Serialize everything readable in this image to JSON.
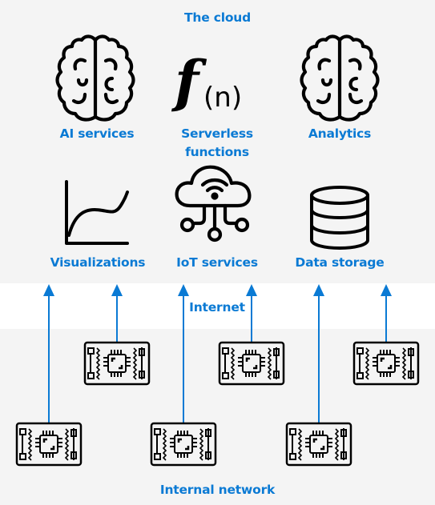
{
  "accent_color": "#0a7ad4",
  "zones": {
    "cloud": "The cloud",
    "internet": "Internet",
    "internal": "Internal network"
  },
  "services": [
    {
      "label": "AI services",
      "icon": "brain-icon"
    },
    {
      "label": "Serverless functions",
      "icon": "function-icon",
      "line1": "Serverless",
      "line2": "functions",
      "glyph_main": "f",
      "glyph_sub": "(n)"
    },
    {
      "label": "Analytics",
      "icon": "brain-icon"
    },
    {
      "label": "Visualizations",
      "icon": "line-chart-icon"
    },
    {
      "label": "IoT services",
      "icon": "iot-cloud-icon"
    },
    {
      "label": "Data storage",
      "icon": "database-icon"
    }
  ],
  "devices": {
    "count": 6,
    "icon": "circuit-board-icon"
  }
}
